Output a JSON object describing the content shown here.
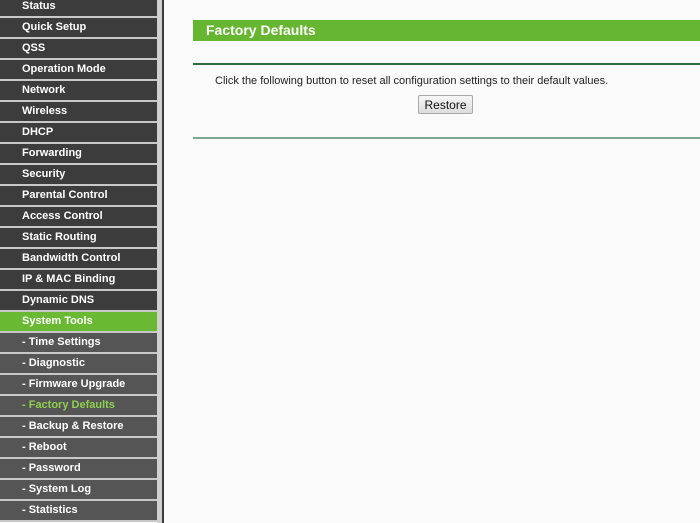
{
  "sidebar": {
    "items": [
      {
        "label": "Status",
        "type": "main"
      },
      {
        "label": "Quick Setup",
        "type": "main"
      },
      {
        "label": "QSS",
        "type": "main"
      },
      {
        "label": "Operation Mode",
        "type": "main"
      },
      {
        "label": "Network",
        "type": "main"
      },
      {
        "label": "Wireless",
        "type": "main"
      },
      {
        "label": "DHCP",
        "type": "main"
      },
      {
        "label": "Forwarding",
        "type": "main"
      },
      {
        "label": "Security",
        "type": "main"
      },
      {
        "label": "Parental Control",
        "type": "main"
      },
      {
        "label": "Access Control",
        "type": "main"
      },
      {
        "label": "Static Routing",
        "type": "main"
      },
      {
        "label": "Bandwidth Control",
        "type": "main"
      },
      {
        "label": "IP & MAC Binding",
        "type": "main"
      },
      {
        "label": "Dynamic DNS",
        "type": "main"
      },
      {
        "label": "System Tools",
        "type": "main",
        "active": true
      },
      {
        "label": "- Time Settings",
        "type": "sub"
      },
      {
        "label": "- Diagnostic",
        "type": "sub"
      },
      {
        "label": "- Firmware Upgrade",
        "type": "sub"
      },
      {
        "label": "- Factory Defaults",
        "type": "sub",
        "current": true
      },
      {
        "label": "- Backup & Restore",
        "type": "sub"
      },
      {
        "label": "- Reboot",
        "type": "sub"
      },
      {
        "label": "- Password",
        "type": "sub"
      },
      {
        "label": "- System Log",
        "type": "sub"
      },
      {
        "label": "- Statistics",
        "type": "sub"
      }
    ]
  },
  "main": {
    "title": "Factory Defaults",
    "description": "Click the following button to reset all configuration settings to their default values.",
    "restore_label": "Restore"
  },
  "colors": {
    "accent_green": "#66b631",
    "current_subitem": "#8fd14f",
    "nav_bg": "#3c3c3c",
    "subnav_bg": "#555555"
  }
}
